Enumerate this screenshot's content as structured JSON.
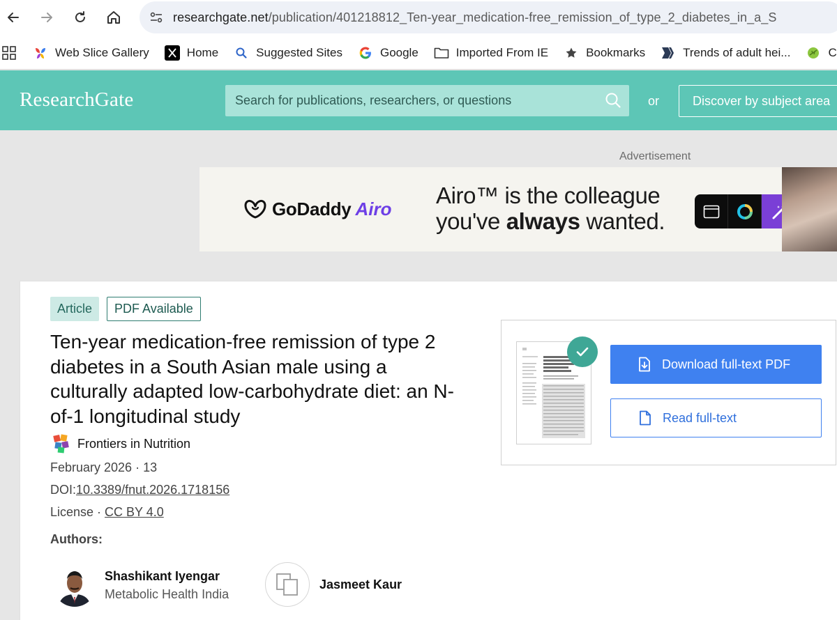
{
  "browser": {
    "url_host": "researchgate.net",
    "url_path": "/publication/401218812_Ten-year_medication-free_remission_of_type_2_diabetes_in_a_S",
    "nav_icons": [
      "back-icon",
      "forward-icon",
      "reload-icon",
      "home-icon",
      "site-info-icon"
    ]
  },
  "bookmarks": [
    {
      "label": "Web Slice Gallery",
      "icon": "web-slice-icon"
    },
    {
      "label": "Home",
      "icon": "x-logo-icon"
    },
    {
      "label": "Suggested Sites",
      "icon": "search-icon"
    },
    {
      "label": "Google",
      "icon": "google-icon"
    },
    {
      "label": "Imported From IE",
      "icon": "folder-icon"
    },
    {
      "label": "Bookmarks",
      "icon": "star-icon"
    },
    {
      "label": "Trends of adult hei...",
      "icon": "bookmark-page-icon"
    },
    {
      "label": "C",
      "icon": "leaf-icon"
    }
  ],
  "header": {
    "logo": "ResearchGate",
    "search_placeholder": "Search for publications, researchers, or questions",
    "or": "or",
    "discover": "Discover by subject area"
  },
  "ad": {
    "label": "Advertisement",
    "brand": "GoDaddy",
    "product": "Airo",
    "line1": "Airo™ is the colleague",
    "line2_pre": "you've ",
    "line2_bold": "always",
    "line2_post": " wanted."
  },
  "article": {
    "badge_article": "Article",
    "badge_pdf": "PDF Available",
    "title": "Ten-year medication-free remission of type 2 diabetes in a South Asian male using a culturally adapted low-carbohydrate diet: an N-of-1 longitudinal study",
    "journal": "Frontiers in Nutrition",
    "date": "February 2026 · 13",
    "doi_label": "DOI:",
    "doi": "10.3389/fnut.2026.1718156",
    "license_label": "License · ",
    "license": "CC BY 4.0",
    "authors_heading": "Authors:",
    "authors": [
      {
        "name": "Shashikant Iyengar",
        "affiliation": "Metabolic Health India"
      },
      {
        "name": "Jasmeet Kaur",
        "affiliation": ""
      }
    ]
  },
  "pdf_panel": {
    "download": "Download full-text PDF",
    "read": "Read full-text"
  },
  "colors": {
    "header_teal": "#5dc6b6",
    "button_blue": "#3f81f0",
    "check_green": "#3fa796"
  }
}
